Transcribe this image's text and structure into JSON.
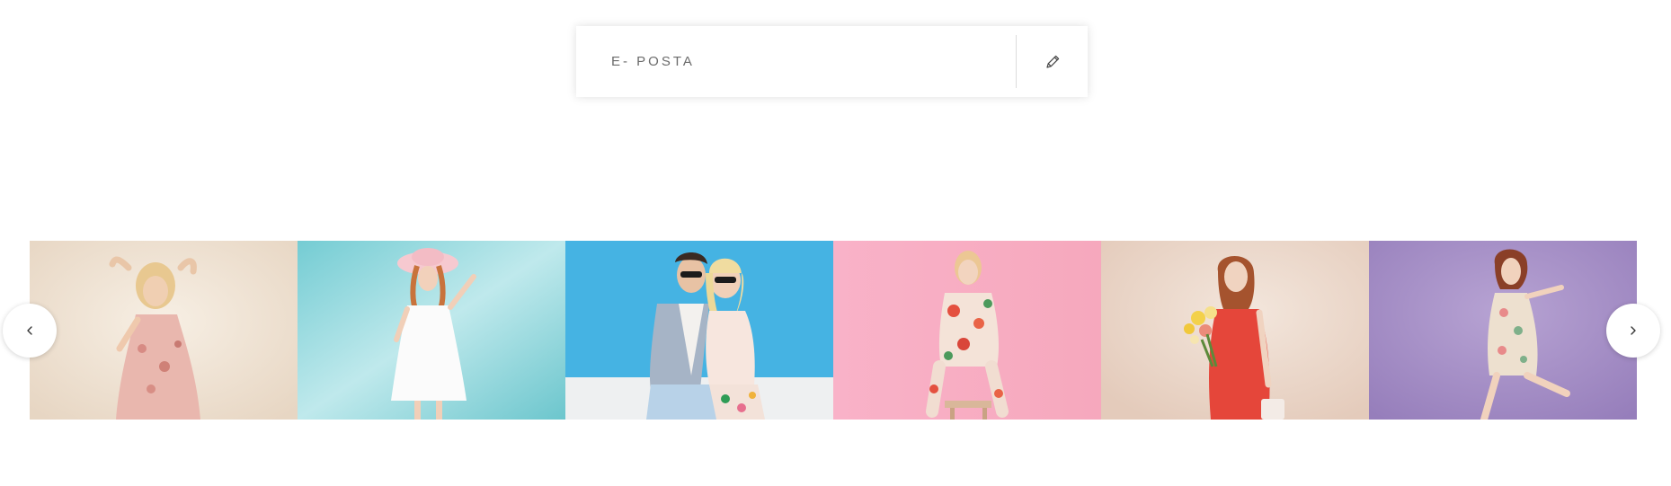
{
  "newsletter": {
    "email_placeholder": "E- POSTA",
    "submit_icon": "pencil-icon"
  },
  "gallery": {
    "prev_icon": "chevron-left-icon",
    "next_icon": "chevron-right-icon",
    "items": [
      {
        "bg": "#efe4d6",
        "subject": "woman-floral-dress"
      },
      {
        "bg": "#a9dfe3",
        "subject": "woman-white-dress-hat"
      },
      {
        "bg": "#43b1e0",
        "subject": "couple-sunglasses"
      },
      {
        "bg": "#f6aec4",
        "subject": "woman-floral-suit"
      },
      {
        "bg": "#ecd9cd",
        "subject": "woman-red-dress-flowers"
      },
      {
        "bg": "#a28bc4",
        "subject": "woman-floral-dress-purple"
      }
    ]
  }
}
